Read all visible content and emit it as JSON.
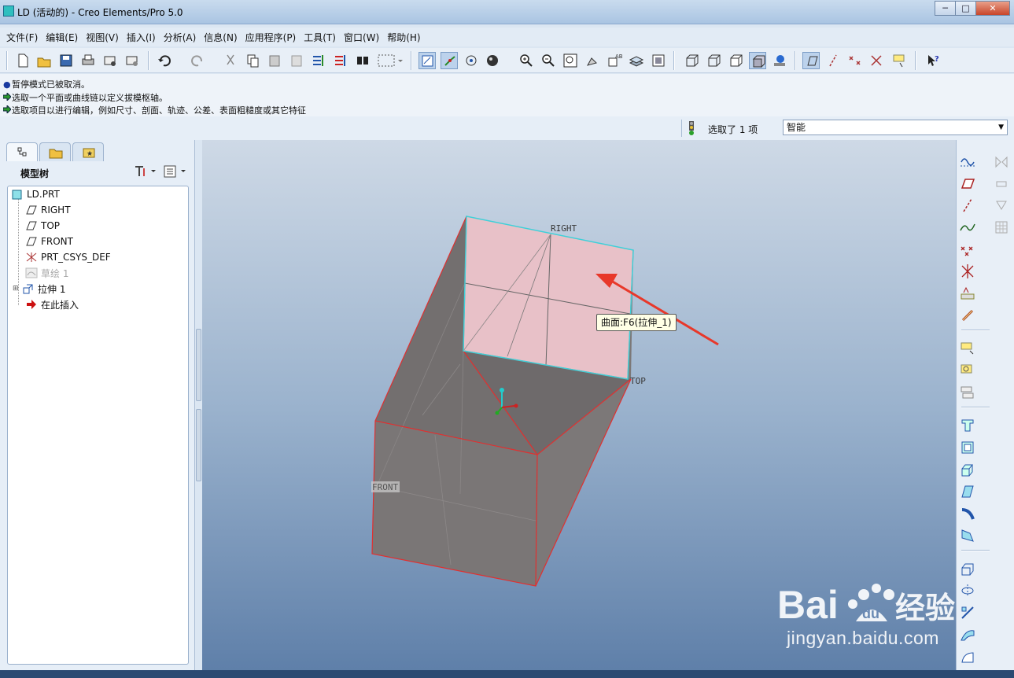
{
  "window": {
    "title": "LD (活动的) - Creo Elements/Pro 5.0",
    "buttons": [
      "─",
      "□",
      "✕"
    ]
  },
  "menu": [
    "文件(F)",
    "编辑(E)",
    "视图(V)",
    "插入(I)",
    "分析(A)",
    "信息(N)",
    "应用程序(P)",
    "工具(T)",
    "窗口(W)",
    "帮助(H)"
  ],
  "messages": [
    "暂停模式已被取消。",
    "选取一个平面或曲线链以定义拔模枢轴。",
    "选取项目以进行编辑，例如尺寸、剖面、轨迹、公差、表面粗糙度或其它特征"
  ],
  "status": {
    "selected": "选取了 1 项",
    "filter": "智能"
  },
  "model_tree": {
    "title": "模型树",
    "items": [
      {
        "label": "LD.PRT",
        "icon": "part-icon",
        "dim": false
      },
      {
        "label": "RIGHT",
        "icon": "datum-plane-icon",
        "dim": false
      },
      {
        "label": "TOP",
        "icon": "datum-plane-icon",
        "dim": false
      },
      {
        "label": "FRONT",
        "icon": "datum-plane-icon",
        "dim": false
      },
      {
        "label": "PRT_CSYS_DEF",
        "icon": "csys-icon",
        "dim": false
      },
      {
        "label": "草绘 1",
        "icon": "sketch-icon",
        "dim": true
      },
      {
        "label": "拉伸 1",
        "icon": "extrude-icon",
        "dim": false
      },
      {
        "label": "在此插入",
        "icon": "insert-here-arrow-icon",
        "dim": false
      }
    ]
  },
  "viewport": {
    "plane_labels": {
      "right": "RIGHT",
      "top": "TOP",
      "front": "FRONT"
    },
    "tooltip": "曲面:F6(拉伸_1)",
    "colors": {
      "selected_face": "#e8c1c8",
      "body": "#7c7878",
      "edge": "#e03030",
      "highlight_edge": "#3fd0d8",
      "arrow": "#e8382a"
    }
  },
  "watermark": {
    "brand": "Baidu经验",
    "url": "jingyan.baidu.com"
  }
}
